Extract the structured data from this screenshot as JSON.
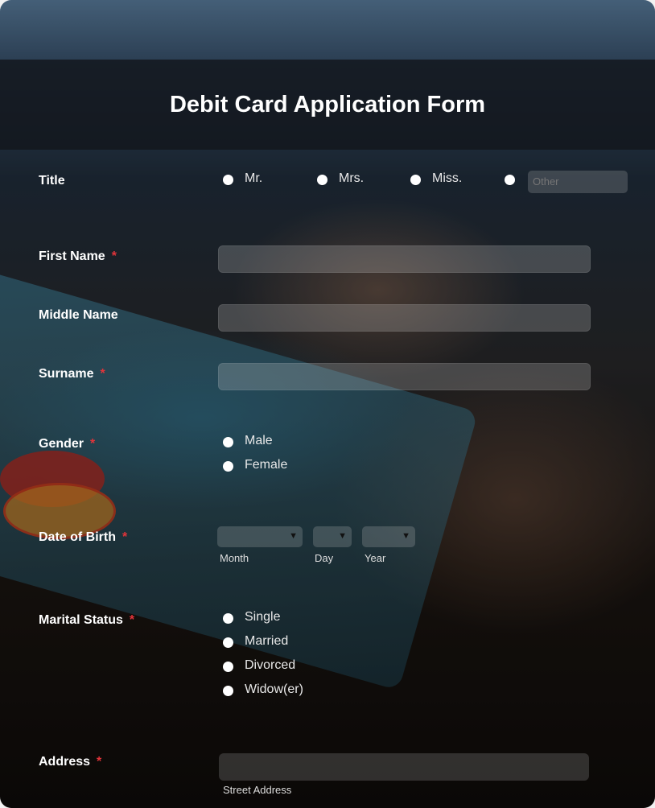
{
  "form": {
    "title": "Debit Card Application Form",
    "fields": {
      "title": {
        "label": "Title",
        "options": [
          "Mr.",
          "Mrs.",
          "Miss."
        ],
        "other_placeholder": "Other"
      },
      "first_name": {
        "label": "First Name",
        "required": "*"
      },
      "middle_name": {
        "label": "Middle Name"
      },
      "surname": {
        "label": "Surname",
        "required": "*"
      },
      "gender": {
        "label": "Gender",
        "required": "*",
        "options": [
          "Male",
          "Female"
        ]
      },
      "dob": {
        "label": "Date of Birth",
        "required": "*",
        "month_label": "Month",
        "day_label": "Day",
        "year_label": "Year"
      },
      "marital_status": {
        "label": "Marital Status",
        "required": "*",
        "options": [
          "Single",
          "Married",
          "Divorced",
          "Widow(er)"
        ]
      },
      "address": {
        "label": "Address",
        "required": "*",
        "street_label": "Street Address"
      }
    }
  },
  "icons": {
    "caret": "▼"
  },
  "colors": {
    "required": "#e2343a",
    "header_bg": "#12161c"
  }
}
